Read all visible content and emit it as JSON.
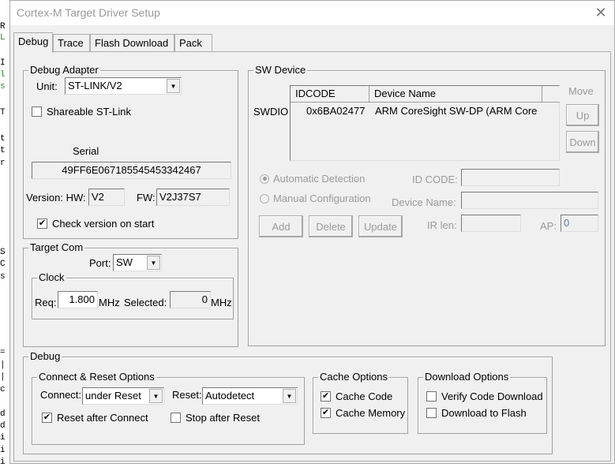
{
  "background_editor": {
    "letters": [
      "R",
      "L",
      "I",
      "l",
      "s",
      "T",
      "t",
      "t",
      "r",
      "S",
      "C",
      "s",
      "=",
      "|",
      "|",
      "c",
      "d",
      "d",
      "i",
      "i",
      "i"
    ]
  },
  "window": {
    "title": "Cortex-M Target Driver Setup",
    "close_icon": "close-icon"
  },
  "tabs": [
    {
      "label": "Debug",
      "active": true
    },
    {
      "label": "Trace",
      "active": false
    },
    {
      "label": "Flash Download",
      "active": false
    },
    {
      "label": "Pack",
      "active": false
    }
  ],
  "debug_adapter": {
    "legend": "Debug Adapter",
    "unit_label": "Unit:",
    "unit_value": "ST-LINK/V2",
    "shareable_label": "Shareable ST-Link",
    "shareable_checked": false,
    "serial_label": "Serial",
    "serial_value": "49FF6E067185545453342467",
    "version_label": "Version: HW:",
    "hw_value": "V2",
    "fw_label": "FW:",
    "fw_value": "V2J37S7",
    "check_version_label": "Check version on start",
    "check_version_checked": true
  },
  "target_com": {
    "legend": "Target Com",
    "port_label": "Port:",
    "port_value": "SW",
    "clock": {
      "legend": "Clock",
      "req_label": "Req:",
      "req_value": "1.800",
      "req_unit": "MHz",
      "selected_label": "Selected:",
      "selected_value": "0",
      "selected_unit": "MHz"
    }
  },
  "sw_device": {
    "legend": "SW Device",
    "row_label": "SWDIO",
    "columns": [
      "IDCODE",
      "Device Name"
    ],
    "rows": [
      {
        "idcode": "0x6BA02477",
        "device_name": "ARM CoreSight SW-DP (ARM Core"
      }
    ],
    "move_label": "Move",
    "up_label": "Up",
    "down_label": "Down",
    "automatic_label": "Automatic Detection",
    "manual_label": "Manual Configuration",
    "detection_mode": "automatic",
    "id_code_label": "ID CODE:",
    "id_code_value": "",
    "device_name_label": "Device Name:",
    "device_name_value": "",
    "ir_len_label": "IR len:",
    "ir_len_value": "",
    "ap_label": "AP:",
    "ap_value": "0",
    "add_label": "Add",
    "delete_label": "Delete",
    "update_label": "Update"
  },
  "debug": {
    "legend": "Debug",
    "connect_reset": {
      "legend": "Connect & Reset Options",
      "connect_label": "Connect:",
      "connect_value": "under Reset",
      "reset_label": "Reset:",
      "reset_value": "Autodetect",
      "reset_after_connect_label": "Reset after Connect",
      "reset_after_connect_checked": true,
      "stop_after_reset_label": "Stop after Reset",
      "stop_after_reset_checked": false
    },
    "cache_options": {
      "legend": "Cache Options",
      "cache_code_label": "Cache Code",
      "cache_code_checked": true,
      "cache_memory_label": "Cache Memory",
      "cache_memory_checked": true
    },
    "download_options": {
      "legend": "Download Options",
      "verify_label": "Verify Code Download",
      "verify_checked": false,
      "download_flash_label": "Download to Flash",
      "download_flash_checked": false
    }
  },
  "colors": {
    "dialog_bg": "#f0f0f0",
    "border": "#a0a0a0",
    "disabled_text": "#9a9a9a"
  }
}
